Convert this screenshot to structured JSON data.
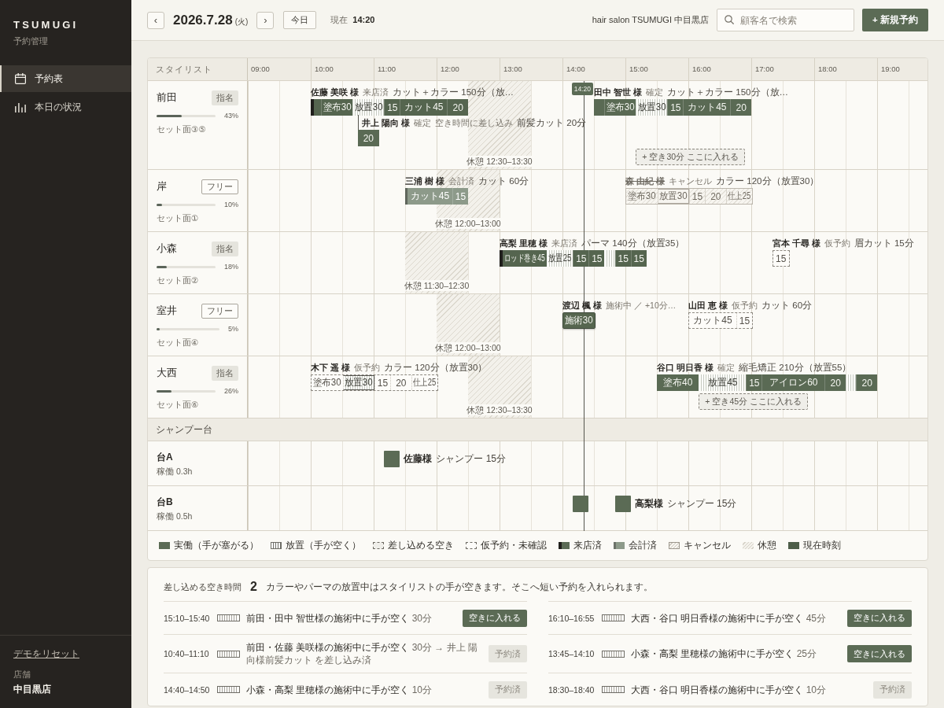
{
  "sidebar": {
    "logo": "TSUMUGI",
    "subtitle": "予約管理",
    "nav": [
      {
        "label": "予約表",
        "selected": true
      },
      {
        "label": "本日の状況",
        "selected": false
      }
    ],
    "reset_link": "デモをリセット",
    "store_label": "店舗",
    "store_name": "中目黒店"
  },
  "header": {
    "prev_button": "‹",
    "date": "2026.7.28",
    "weekday": "(火)",
    "next_button": "›",
    "today_button": "今日",
    "now_label": "現在",
    "now_time": "14:20",
    "salon_name": "hair salon TSUMUGI 中目黒店",
    "search": {
      "placeholder": "顧客名で検索"
    },
    "new_booking_button": "+ 新規予約"
  },
  "timeline": {
    "stylist_header": "スタイリスト",
    "hours": [
      "09:00",
      "10:00",
      "11:00",
      "12:00",
      "13:00",
      "14:00",
      "15:00",
      "16:00",
      "17:00",
      "18:00",
      "19:00"
    ],
    "now_marker": "14:20",
    "stylists": [
      {
        "name": "前田",
        "badge": {
          "kind": "nominated",
          "label": "指名"
        },
        "level": 0.43,
        "utilization": "43%",
        "seat": "セット面③⑤",
        "break": {
          "label": "休憩 12:30–13:30"
        },
        "lanes": [
          {
            "bookings": [
              {
                "kind": "arrived",
                "name": "佐藤 美咲 様",
                "status": "来店済",
                "menu": "カット＋カラー 150分（放…",
                "segments": [
                  {
                    "kind": "work"
                  },
                  {
                    "kind": "work",
                    "label": "塗布30"
                  },
                  {
                    "kind": "wait",
                    "label": "放置30"
                  },
                  {
                    "kind": "work",
                    "label": "15"
                  },
                  {
                    "kind": "work",
                    "label": "カット45"
                  },
                  {
                    "kind": "work",
                    "label": "20"
                  }
                ]
              },
              {
                "kind": "confirmed",
                "name": "田中 智世 様",
                "status": "確定",
                "menu": "カット＋カラー 150分（放…",
                "segments": [
                  {
                    "kind": "work"
                  },
                  {
                    "kind": "work",
                    "label": "塗布30"
                  },
                  {
                    "kind": "wait",
                    "label": "放置30"
                  },
                  {
                    "kind": "work",
                    "label": "15"
                  },
                  {
                    "kind": "work",
                    "label": "カット45"
                  },
                  {
                    "kind": "work",
                    "label": "20"
                  }
                ]
              }
            ]
          },
          {
            "bookings": [
              {
                "kind": "confirmed",
                "name": "井上 陽向 様",
                "status": "確定",
                "note": "空き時間に差し込み",
                "menu": "前髪カット 20分",
                "linked": true,
                "segments": [
                  {
                    "kind": "work",
                    "label": "20"
                  }
                ]
              }
            ]
          }
        ],
        "gaps": [
          {
            "label": "+ 空き30分 ここに入れる"
          }
        ]
      },
      {
        "name": "岸",
        "badge": {
          "kind": "free",
          "label": "フリー"
        },
        "level": 0.1,
        "utilization": "10%",
        "seat": "セット面①",
        "break": {
          "label": "休憩 12:00–13:00"
        },
        "lanes": [
          {
            "bookings": [
              {
                "kind": "paid",
                "name": "三浦 樹 様",
                "status": "会計済",
                "menu": "カット 60分",
                "segments": [
                  {
                    "kind": "work",
                    "label": "カット45"
                  },
                  {
                    "kind": "work",
                    "label": "15"
                  }
                ]
              },
              {
                "kind": "cancelled",
                "name": "森 由紀 様",
                "status": "キャンセル",
                "menu": "カラー 120分（放置30）",
                "segments": [
                  {
                    "kind": "work",
                    "label": "塗布30"
                  },
                  {
                    "kind": "wait",
                    "label": "放置30"
                  },
                  {
                    "kind": "work",
                    "label": "15"
                  },
                  {
                    "kind": "work",
                    "label": "20"
                  },
                  {
                    "kind": "work",
                    "label": "仕上25"
                  }
                ]
              }
            ]
          }
        ]
      },
      {
        "name": "小森",
        "badge": {
          "kind": "nominated",
          "label": "指名"
        },
        "level": 0.18,
        "utilization": "18%",
        "seat": "セット面②",
        "break": {
          "label": "休憩 11:30–12:30"
        },
        "lanes": [
          {
            "bookings": [
              {
                "kind": "arrived",
                "name": "高梨 里穂 様",
                "status": "来店済",
                "menu": "パーマ 140分（放置35）",
                "segments": [
                  {
                    "kind": "work",
                    "label": "ロッド巻き45"
                  },
                  {
                    "kind": "wait",
                    "label": "放置25"
                  },
                  {
                    "kind": "work",
                    "label": "15"
                  },
                  {
                    "kind": "work",
                    "label": "15"
                  },
                  {
                    "kind": "wait"
                  },
                  {
                    "kind": "work",
                    "label": "15"
                  },
                  {
                    "kind": "work",
                    "label": "15"
                  }
                ]
              },
              {
                "kind": "tentative",
                "name": "宮本 千尋 様",
                "status": "仮予約",
                "menu": "眉カット 15分",
                "segments": [
                  {
                    "kind": "work",
                    "label": "15"
                  }
                ]
              }
            ]
          }
        ]
      },
      {
        "name": "室井",
        "badge": {
          "kind": "free",
          "label": "フリー"
        },
        "level": 0.05,
        "utilization": "5%",
        "seat": "セット面④",
        "break": {
          "label": "休憩 12:00–13:00"
        },
        "lanes": [
          {
            "bookings": [
              {
                "kind": "in_progress",
                "name": "渡辺 楓 様",
                "status": "施術中 ／ +10分…",
                "segments": [
                  {
                    "kind": "work",
                    "label": "施術30"
                  }
                ]
              },
              {
                "kind": "tentative",
                "name": "山田 恵 様",
                "status": "仮予約",
                "menu": "カット 60分",
                "segments": [
                  {
                    "kind": "work",
                    "label": "カット45"
                  },
                  {
                    "kind": "work",
                    "label": "15"
                  }
                ]
              }
            ]
          }
        ]
      },
      {
        "name": "大西",
        "badge": {
          "kind": "nominated",
          "label": "指名"
        },
        "level": 0.26,
        "utilization": "26%",
        "seat": "セット面⑥",
        "break": {
          "label": "休憩 12:30–13:30"
        },
        "lanes": [
          {
            "bookings": [
              {
                "kind": "tentative",
                "name": "木下 遥 様",
                "status": "仮予約",
                "menu": "カラー 120分（放置30）",
                "segments": [
                  {
                    "kind": "work",
                    "label": "塗布30"
                  },
                  {
                    "kind": "wait",
                    "label": "放置30"
                  },
                  {
                    "kind": "work",
                    "label": "15"
                  },
                  {
                    "kind": "work",
                    "label": "20"
                  },
                  {
                    "kind": "work",
                    "label": "仕上25"
                  }
                ]
              },
              {
                "kind": "confirmed",
                "name": "谷口 明日香 様",
                "status": "確定",
                "menu": "縮毛矯正 210分（放置55）",
                "segments": [
                  {
                    "kind": "work",
                    "label": "塗布40"
                  },
                  {
                    "kind": "wait",
                    "label": "放置45"
                  },
                  {
                    "kind": "work",
                    "label": "15"
                  },
                  {
                    "kind": "work",
                    "label": "アイロン60"
                  },
                  {
                    "kind": "work",
                    "label": "20"
                  },
                  {
                    "kind": "wait"
                  },
                  {
                    "kind": "work",
                    "label": "20"
                  }
                ]
              }
            ]
          }
        ],
        "gaps": [
          {
            "label": "+ 空き45分 ここに入れる"
          }
        ]
      }
    ],
    "shampoo_header": "シャンプー台",
    "shampoo_stations": [
      {
        "name": "台A",
        "usage": "稼働 0.3h",
        "bookings": [
          {
            "kind": "shampoo",
            "name": "佐藤様",
            "menu": "シャンプー 15分"
          }
        ]
      },
      {
        "name": "台B",
        "usage": "稼働 0.5h",
        "bookings": [
          {
            "kind": "shampoo"
          },
          {
            "kind": "shampoo",
            "name": "高梨様",
            "menu": "シャンプー 15分"
          }
        ]
      }
    ],
    "legend": [
      {
        "kind": "work",
        "label": "実働（手が塞がる）"
      },
      {
        "kind": "wait",
        "label": "放置（手が空く）"
      },
      {
        "kind": "gap",
        "label": "差し込める空き"
      },
      {
        "kind": "tentative",
        "label": "仮予約・未確認"
      },
      {
        "kind": "arrived",
        "label": "来店済"
      },
      {
        "kind": "paid",
        "label": "会計済"
      },
      {
        "kind": "cancelled",
        "label": "キャンセル"
      },
      {
        "kind": "break",
        "label": "休憩"
      },
      {
        "kind": "now",
        "label": "現在時刻"
      }
    ]
  },
  "gap_panel": {
    "title": "差し込める空き時間",
    "count": "2",
    "description": "カラーやパーマの放置中はスタイリストの手が空きます。そこへ短い予約を入れられます。",
    "slots": [
      {
        "time": "15:10–15:40",
        "text": "前田・田中 智世様の施術中に手が空く",
        "detail": "30分",
        "action": "空きに入れる",
        "booked": false
      },
      {
        "time": "16:10–16:55",
        "text": "大西・谷口 明日香様の施術中に手が空く",
        "detail": "45分",
        "action": "空きに入れる",
        "booked": false
      },
      {
        "time": "10:40–11:10",
        "text": "前田・佐藤 美咲様の施術中に手が空く",
        "detail": "30分 → 井上 陽向様前髪カット を差し込み済",
        "action": "予約済",
        "booked": true
      },
      {
        "time": "13:45–14:10",
        "text": "小森・高梨 里穂様の施術中に手が空く",
        "detail": "25分",
        "action": "空きに入れる",
        "booked": false
      },
      {
        "time": "14:40–14:50",
        "text": "小森・高梨 里穂様の施術中に手が空く",
        "detail": "10分",
        "action": "予約済",
        "booked": true
      },
      {
        "time": "18:30–18:40",
        "text": "大西・谷口 明日香様の施術中に手が空く",
        "detail": "10分",
        "action": "予約済",
        "booked": true
      }
    ]
  }
}
